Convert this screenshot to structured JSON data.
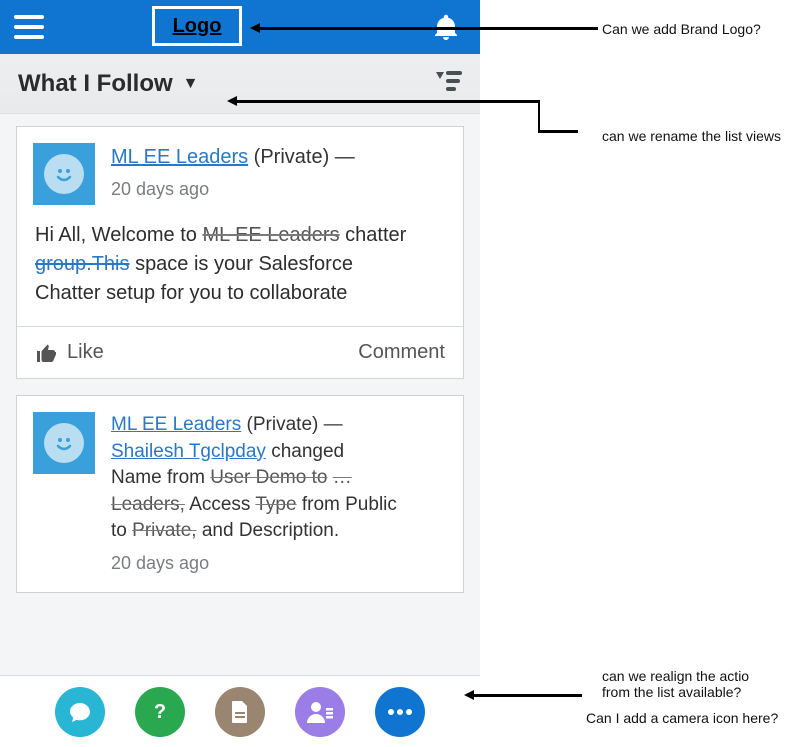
{
  "header": {
    "logo_text": "Logo"
  },
  "subheader": {
    "list_view_title": "What I Follow"
  },
  "feed": {
    "posts": [
      {
        "group_redacted": "ML EE Leaders",
        "privacy": "(Private) —",
        "timestamp": "20 days ago",
        "body_line1": "Hi All, Welcome to",
        "body_redacted_inline": "ML EE Leaders",
        "body_line1b": "chatter",
        "body_redacted2": "group.This",
        "body_line2": "space is your Salesforce",
        "body_line3": "Chatter setup for you to collaborate",
        "like_label": "Like",
        "comment_label": "Comment"
      },
      {
        "group_redacted": "ML EE Leaders",
        "privacy": "(Private) —",
        "actor_redacted": "Shailesh  Tgclpday",
        "changed_text": "changed",
        "line3a": "Name from",
        "line3_strike": "User Demo to",
        "line3_strike2": "…",
        "line4a_strike": "Leaders,",
        "line4b": "Access",
        "line4c_strike": "Type",
        "line4d": "from Public",
        "line5a": "to",
        "line5_strike": "Private,",
        "line5b": "and Description.",
        "timestamp": "20 days ago"
      }
    ]
  },
  "annotations": {
    "a1": "Can we add Brand Logo?",
    "a2": "can we rename the list views",
    "a3": "can we realign the actio",
    "a3b": "from the list available?",
    "a4": "Can I add a camera icon here?"
  }
}
